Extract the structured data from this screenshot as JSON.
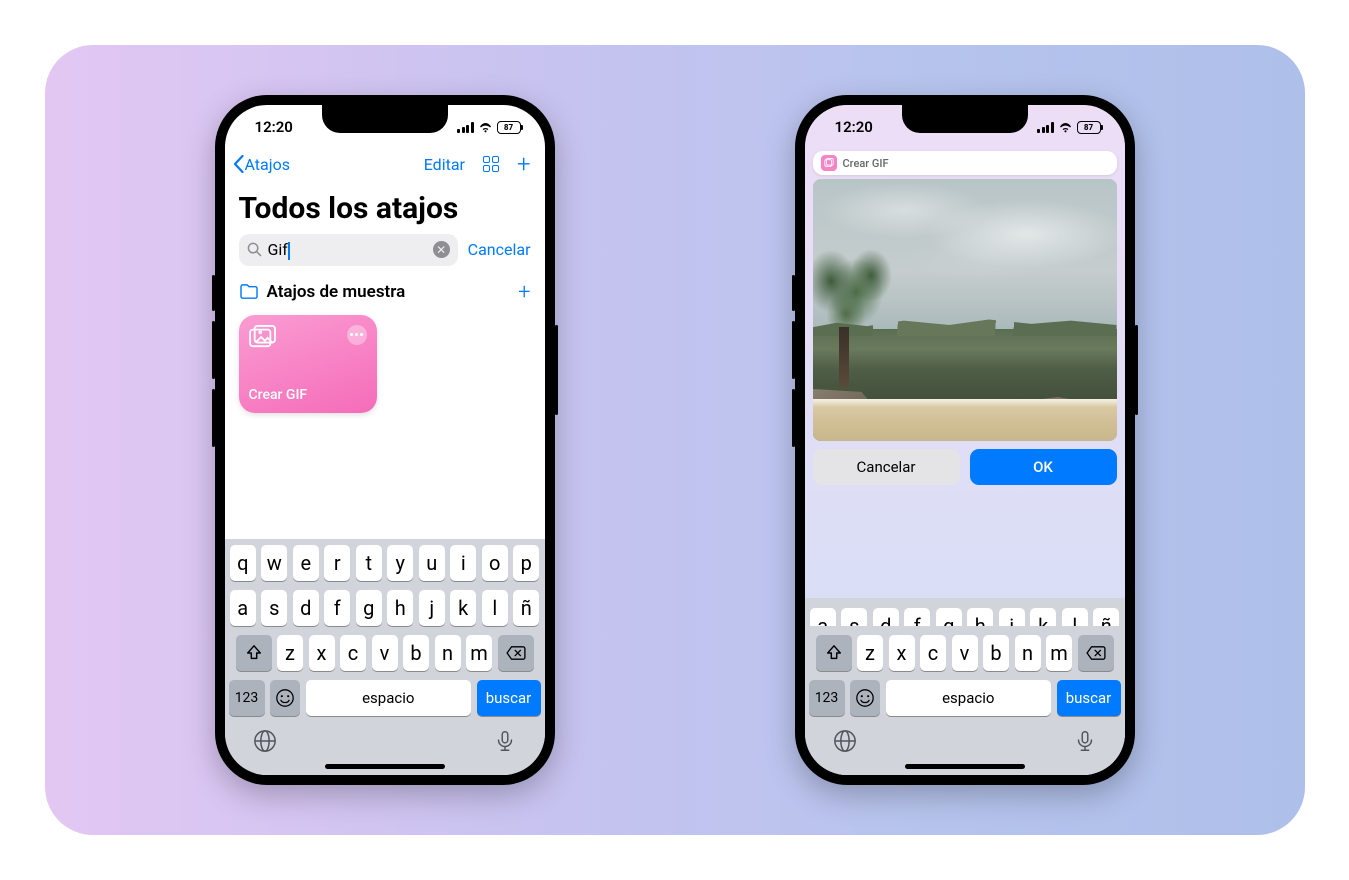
{
  "status": {
    "time": "12:20",
    "battery": "87"
  },
  "phone1": {
    "nav": {
      "back": "Atajos",
      "edit": "Editar"
    },
    "title": "Todos los atajos",
    "search": {
      "value": "Gif",
      "cancel": "Cancelar"
    },
    "folder": {
      "name": "Atajos de muestra"
    },
    "tile": {
      "name": "Crear GIF"
    }
  },
  "phone2": {
    "pill": "Crear GIF",
    "buttons": {
      "cancel": "Cancelar",
      "ok": "OK"
    }
  },
  "keyboard": {
    "row1": [
      "q",
      "w",
      "e",
      "r",
      "t",
      "y",
      "u",
      "i",
      "o",
      "p"
    ],
    "row2": [
      "a",
      "s",
      "d",
      "f",
      "g",
      "h",
      "j",
      "k",
      "l",
      "ñ"
    ],
    "row3": [
      "z",
      "x",
      "c",
      "v",
      "b",
      "n",
      "m"
    ],
    "n123": "123",
    "space": "espacio",
    "search": "buscar"
  }
}
